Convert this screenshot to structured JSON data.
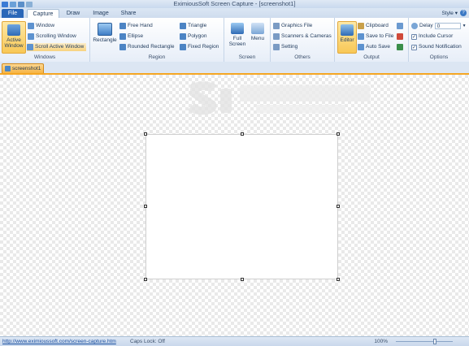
{
  "window": {
    "title": "EximiousSoft Screen Capture - [screenshot1]"
  },
  "ribbon_tabs": [
    {
      "label": "File"
    },
    {
      "label": "Capture"
    },
    {
      "label": "Draw"
    },
    {
      "label": "Image"
    },
    {
      "label": "Share"
    }
  ],
  "style_menu": "Style ▾",
  "groups": {
    "windows": {
      "label": "Windows",
      "active_window": "Active Window",
      "items": [
        "Window",
        "Scrolling Window",
        "Scroll Active Window"
      ]
    },
    "region": {
      "label": "Region",
      "rectangle": "Rectangle",
      "col1": [
        "Free Hand",
        "Ellipse",
        "Rounded Rectangle"
      ],
      "col2": [
        "Triangle",
        "Polygon",
        "Fixed Region"
      ]
    },
    "screen": {
      "label": "Screen",
      "full_screen": "Full Screen",
      "menu": "Menu"
    },
    "others": {
      "label": "Others",
      "items": [
        "Graphics File",
        "Scanners & Cameras",
        "Setting"
      ]
    },
    "output": {
      "label": "Output",
      "editor": "Editor",
      "items": [
        "Clipboard",
        "Save to File",
        "Auto Save"
      ]
    },
    "options": {
      "label": "Options",
      "delay_label": "Delay",
      "delay_value": "0",
      "checks": [
        "Include Cursor",
        "Sound Notification"
      ]
    }
  },
  "document_tab": "screenshot1",
  "status": {
    "link": "http://www.eximioussoft.com/screen-capture.htm",
    "caps_lock": "Caps Lock: Off",
    "zoom": "100%"
  },
  "colors": {
    "accent": "#f5a623",
    "file_tab": "#2a67b8",
    "ribbon_bg": "#e7eef8"
  }
}
